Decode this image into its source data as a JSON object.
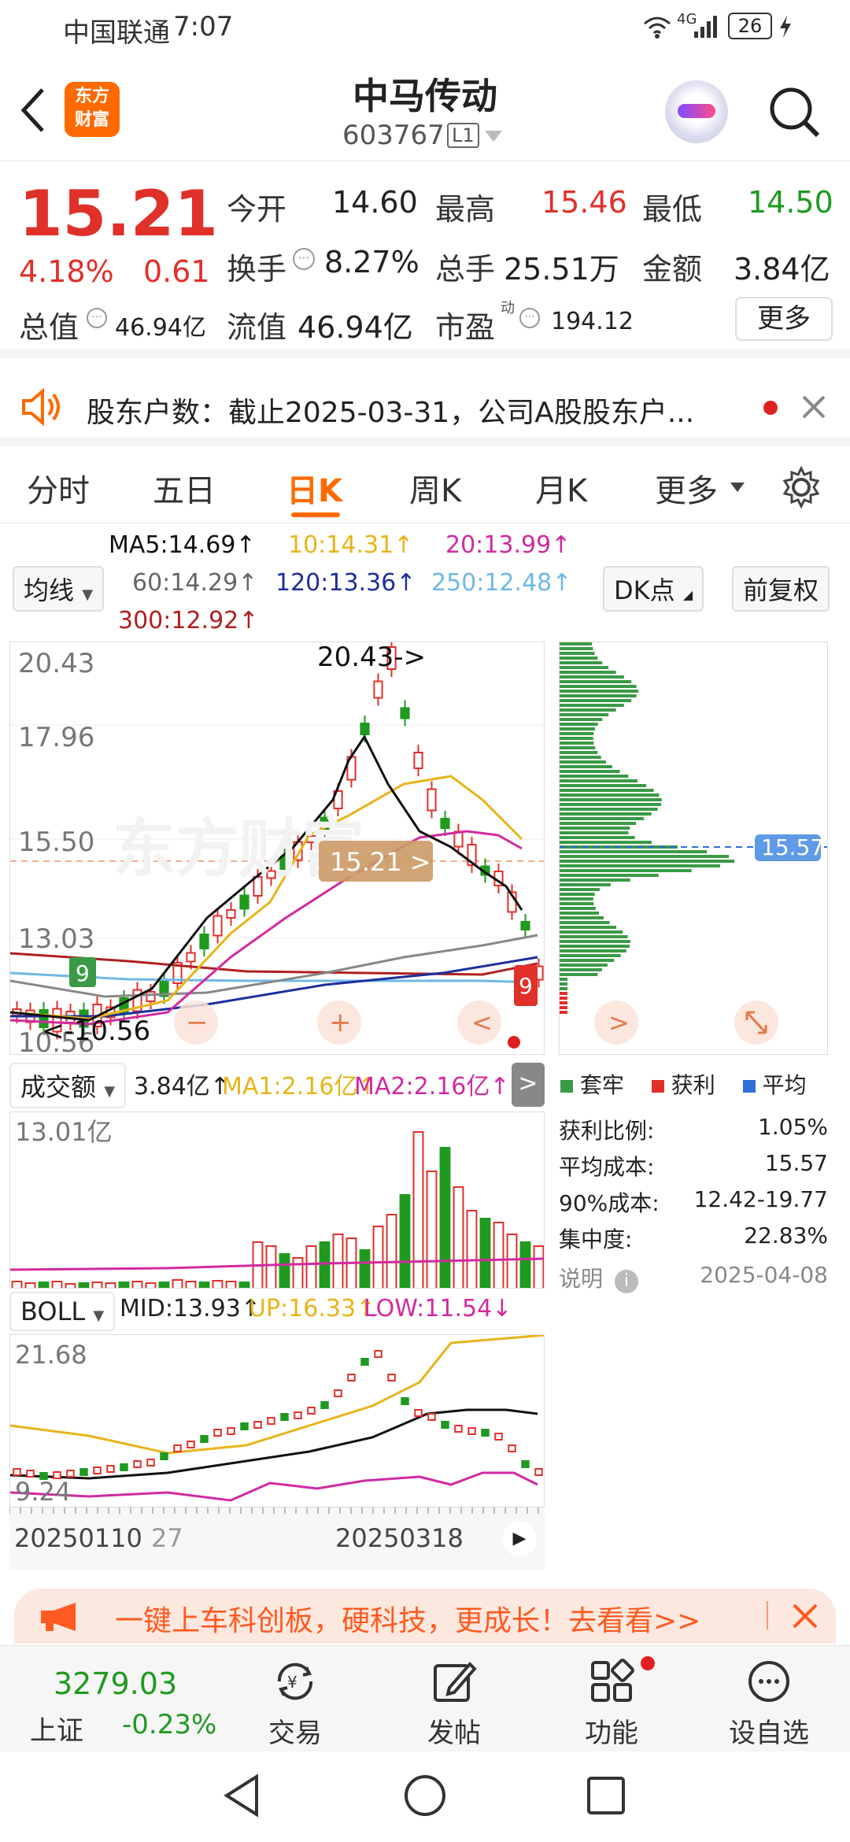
{
  "status_bar": {
    "carrier": "中国联通",
    "time": "7:07",
    "network": "4G",
    "battery": "26"
  },
  "header": {
    "title": "中马传动",
    "code": "603767",
    "level": "L1",
    "logo_text_1": "东方",
    "logo_text_2": "财富"
  },
  "quote": {
    "price": "15.21",
    "change_pct": "4.18%",
    "change": "0.61",
    "open_label": "今开",
    "open": "14.60",
    "high_label": "最高",
    "high": "15.46",
    "low_label": "最低",
    "low": "14.50",
    "turnover_label": "换手",
    "turnover": "8.27%",
    "volume_label": "总手",
    "volume": "25.51万",
    "amount_label": "金额",
    "amount": "3.84亿",
    "mktcap_label": "总值",
    "mktcap": "46.94亿",
    "float_label": "流值",
    "float": "46.94亿",
    "pe_label": "市盈",
    "pe_sup": "动",
    "pe": "194.12",
    "more_label": "更多"
  },
  "notice": {
    "text": "股东户数：截止2025-03-31，公司A股股东户..."
  },
  "tabs": [
    "分时",
    "五日",
    "日K",
    "周K",
    "月K",
    "更多"
  ],
  "active_tab": "日K",
  "ma_legend": {
    "indicator": "均线",
    "ma5": "MA5:14.69↑",
    "ma10": "10:14.31↑",
    "ma20": "20:13.99↑",
    "ma60": "60:14.29↑",
    "ma120": "120:13.36↑",
    "ma250": "250:12.48↑",
    "ma300": "300:12.92↑",
    "dk_label": "DK点",
    "adjust_label": "前复权"
  },
  "kline": {
    "y_labels": [
      "20.43",
      "17.96",
      "15.50",
      "13.03",
      "10.56"
    ],
    "max_annotation": "20.43->",
    "min_annotation": "<-10.56",
    "price_tag": "15.21 >",
    "watermark": "东方财富"
  },
  "chip": {
    "cost_tag": "15.57",
    "legend": [
      "套牢",
      "获利",
      "平均"
    ],
    "rows": [
      {
        "label": "获利比例:",
        "value": "1.05%"
      },
      {
        "label": "平均成本:",
        "value": "15.57"
      },
      {
        "label": "90%成本:",
        "value": "12.42-19.77"
      },
      {
        "label": "集中度:",
        "value": "22.83%"
      }
    ],
    "note_label": "说明",
    "date": "2025-04-08"
  },
  "volume": {
    "indicator": "成交额",
    "value": "3.84亿↑",
    "ma1": "MA1:2.16亿↑",
    "ma2": "MA2:2.16亿↑",
    "y_label": "13.01亿"
  },
  "boll": {
    "indicator": "BOLL",
    "mid": "MID:13.93↑",
    "up": "UP:16.33↑",
    "low": "LOW:11.54↓",
    "y_top": "21.68",
    "y_bottom": "9.24"
  },
  "xaxis": {
    "d1": "20250110",
    "d1b": "27",
    "d2": "20250318"
  },
  "banner": {
    "text": "一键上车科创板，硬科技，更成长！去看看>>"
  },
  "bottom_nav": {
    "index_value": "3279.03",
    "index_name": "上证",
    "index_change": "-0.23%",
    "items": [
      "交易",
      "发帖",
      "功能",
      "设自选"
    ]
  },
  "colors": {
    "accent": "#ff6a00",
    "up": "#e0302a",
    "down": "#1f9a1f",
    "ma5": "#000000",
    "ma10": "#e8b41a",
    "ma20": "#d22aa0",
    "ma60": "#888888",
    "ma120": "#1d2f9a",
    "ma250": "#6fb8e6",
    "ma300": "#b02020"
  }
}
